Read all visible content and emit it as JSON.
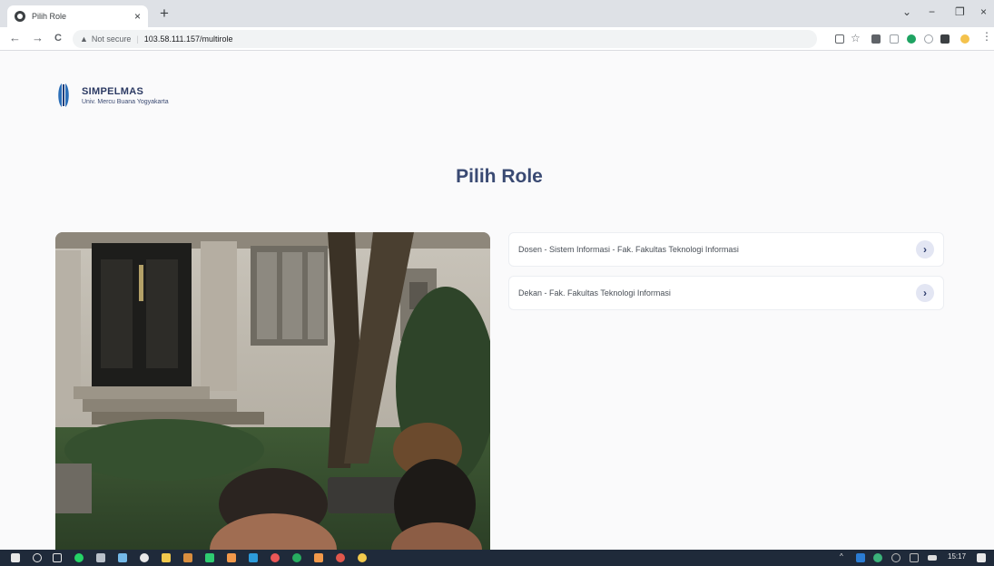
{
  "browser": {
    "tab_title": "Pilih Role",
    "tab_close": "×",
    "new_tab": "+",
    "minimize": "⌄",
    "min": "−",
    "restore": "❐",
    "close": "×",
    "back": "←",
    "forward": "→",
    "reload": "C",
    "security_label": "Not secure",
    "url": "103.58.111.157/multirole",
    "toolbar_icons": [
      "share-icon",
      "star-icon",
      "cast-icon",
      "tab-search-icon",
      "extension-green-icon",
      "extension-grey-icon",
      "puzzle-icon",
      "profile-icon",
      "menu-icon"
    ]
  },
  "brand": {
    "name": "SIMPELMAS",
    "subtitle": "Univ. Mercu Buana Yogyakarta",
    "color": "#2c3a63"
  },
  "page": {
    "title": "Pilih Role"
  },
  "roles": [
    {
      "label": "Dosen - Sistem Informasi - Fak. Fakultas Teknologi Informasi",
      "arrow": "›"
    },
    {
      "label": "Dekan - Fak. Fakultas Teknologi Informasi",
      "arrow": "›"
    }
  ],
  "taskbar": {
    "time": "15:17",
    "apps": [
      "windows-icon",
      "search-icon",
      "task-view-icon",
      "whatsapp-icon",
      "notes-icon",
      "app-icon",
      "chrome-icon",
      "mail-icon",
      "stack-icon",
      "terminal-icon",
      "app2-icon",
      "vscode-icon",
      "office-icon",
      "edge-icon",
      "brave-icon",
      "firefox-icon",
      "chrome-canary-icon"
    ],
    "tray_icons": [
      "chevron-up-icon",
      "word-icon",
      "network-app-icon",
      "wifi-icon",
      "volume-icon",
      "battery-icon",
      "notification-icon"
    ]
  }
}
